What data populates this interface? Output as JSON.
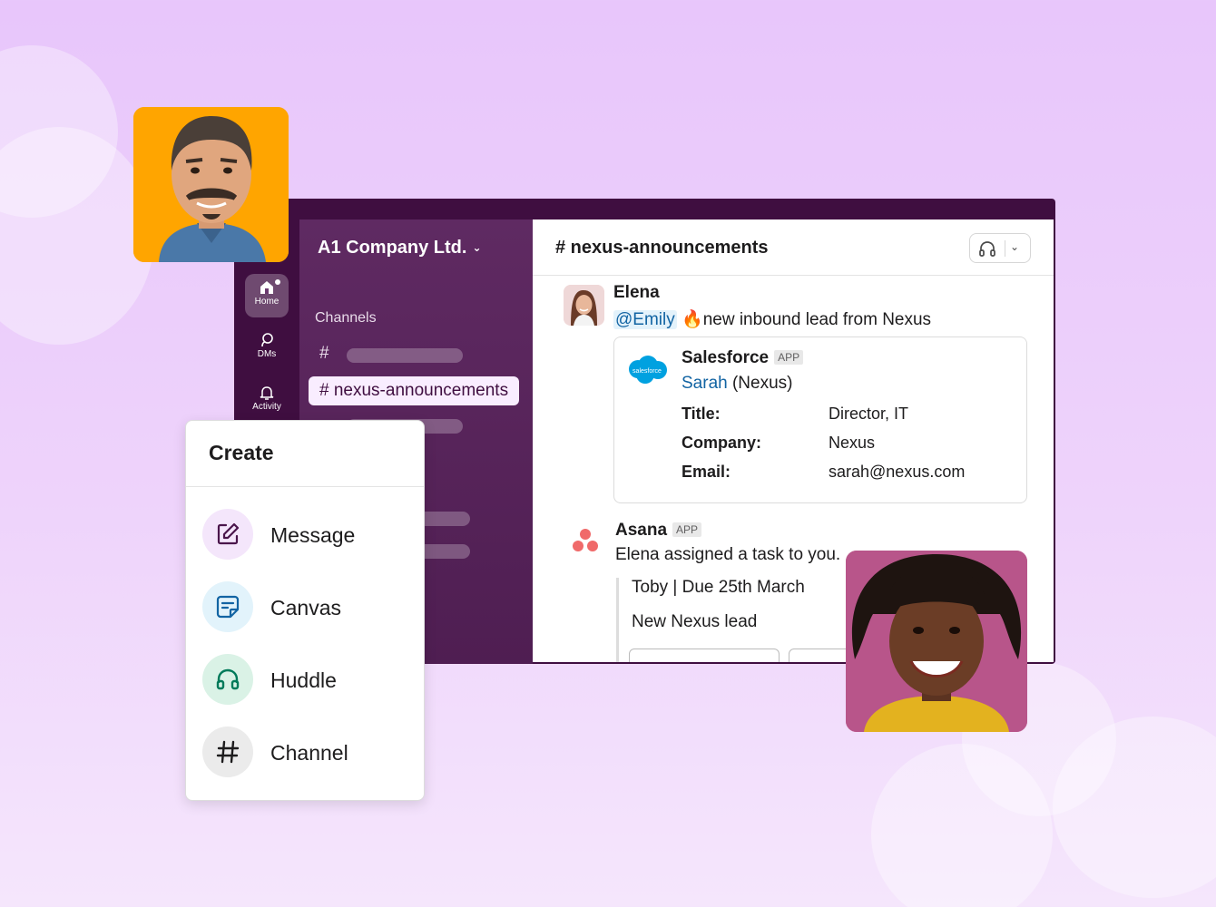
{
  "workspace": {
    "name": "A1 Company Ltd."
  },
  "rail": {
    "items": [
      {
        "label": "Home",
        "icon": "home-icon",
        "active": true
      },
      {
        "label": "DMs",
        "icon": "dms-icon"
      },
      {
        "label": "Activity",
        "icon": "bell-icon"
      }
    ]
  },
  "sidebar": {
    "section_label": "Channels",
    "selected_channel": "# nexus-announcements",
    "hash": "#"
  },
  "channel": {
    "title": "# nexus-announcements",
    "header_icon": "headphones-icon",
    "header_chevron": "⌄"
  },
  "messages": {
    "elena": {
      "name": "Elena",
      "mention": "@Emily",
      "emoji": "🔥",
      "text": "new inbound lead from Nexus"
    },
    "salesforce": {
      "app_name": "Salesforce",
      "badge": "APP",
      "logo_text": "salesforce",
      "contact_name": "Sarah",
      "contact_org": "(Nexus)",
      "fields": [
        {
          "key": "Title:",
          "value": "Director, IT"
        },
        {
          "key": "Company:",
          "value": "Nexus"
        },
        {
          "key": "Email:",
          "value": "sarah@nexus.com"
        }
      ]
    },
    "asana": {
      "app_name": "Asana",
      "badge": "APP",
      "text": "Elena assigned a task to you.",
      "task_line_1": "Toby | Due 25th March",
      "task_line_2": "New Nexus lead"
    }
  },
  "create_menu": {
    "title": "Create",
    "items": [
      {
        "label": "Message",
        "icon": "compose-icon",
        "bg": "#f4e6fb",
        "color": "#4a154b"
      },
      {
        "label": "Canvas",
        "icon": "canvas-icon",
        "bg": "#e2f3fb",
        "color": "#1264a3"
      },
      {
        "label": "Huddle",
        "icon": "headphones-icon",
        "bg": "#daf2e6",
        "color": "#007a5a"
      },
      {
        "label": "Channel",
        "icon": "hash-icon",
        "bg": "#ebebeb",
        "color": "#1d1c1d"
      }
    ]
  },
  "colors": {
    "aubergine": "#3f0e40",
    "sidebar": "#5f2a62",
    "link": "#1264a3",
    "background": "#e8c6fb"
  }
}
